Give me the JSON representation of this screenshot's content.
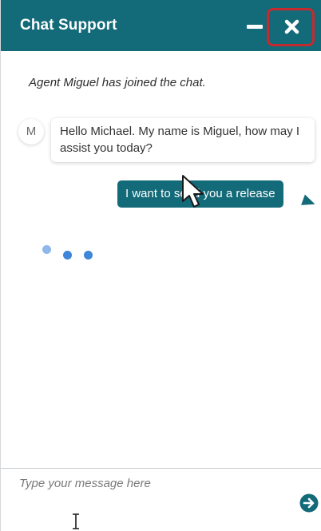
{
  "header": {
    "title": "Chat Support",
    "minimize_icon": "minimize-icon",
    "close_icon": "close-icon",
    "background_color": "#136a78",
    "close_highlight_color": "#c52a2f"
  },
  "conversation": {
    "system_message": "Agent Miguel has joined the chat.",
    "agent": {
      "avatar_initial": "M",
      "message": "Hello Michael. My name is Miguel, how may I assist you today?"
    },
    "user": {
      "message": "I want to send you a release"
    },
    "typing_indicator": {
      "dot_count": 3,
      "color": "#3d86d8"
    }
  },
  "composer": {
    "placeholder": "Type your message here",
    "value": "",
    "send_icon": "arrow-right-circle-icon"
  },
  "cursors": {
    "pointer_icon": "mouse-pointer-icon",
    "text_cursor_icon": "text-cursor-icon"
  }
}
